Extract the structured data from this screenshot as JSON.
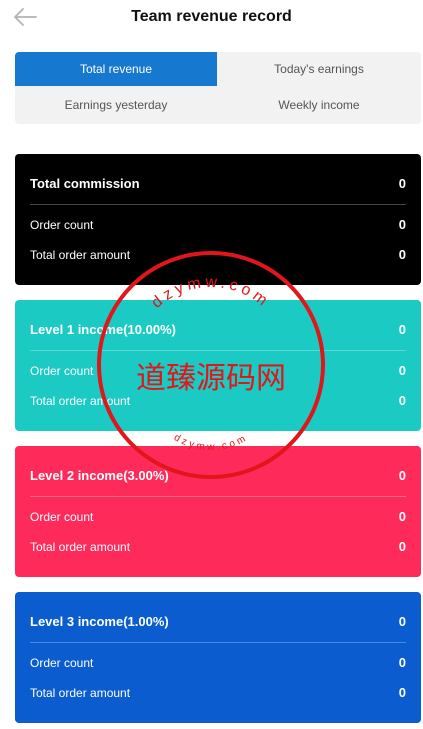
{
  "header": {
    "title": "Team revenue record"
  },
  "tabs": [
    {
      "label": "Total revenue",
      "active": true
    },
    {
      "label": "Today's earnings",
      "active": false
    },
    {
      "label": "Earnings yesterday",
      "active": false
    },
    {
      "label": "Weekly income",
      "active": false
    }
  ],
  "cards": [
    {
      "title": "Total commission",
      "title_value": "0",
      "order_count_label": "Order count",
      "order_count": "0",
      "order_amount_label": "Total order amount",
      "order_amount": "0",
      "color": "#000000"
    },
    {
      "title": "Level 1 income(10.00%)",
      "title_value": "0",
      "order_count_label": "Order count",
      "order_count": "0",
      "order_amount_label": "Total order amount",
      "order_amount": "0",
      "color": "#1ccac4"
    },
    {
      "title": "Level 2 income(3.00%)",
      "title_value": "0",
      "order_count_label": "Order count",
      "order_count": "0",
      "order_amount_label": "Total order amount",
      "order_amount": "0",
      "color": "#fe2b5a"
    },
    {
      "title": "Level 3 income(1.00%)",
      "title_value": "0",
      "order_count_label": "Order count",
      "order_count": "0",
      "order_amount_label": "Total order amount",
      "order_amount": "0",
      "color": "#0a5ccf"
    }
  ],
  "watermark": {
    "center_text": "道臻源码网",
    "ring_text": "dzymw.com",
    "color": "#e0161b"
  }
}
